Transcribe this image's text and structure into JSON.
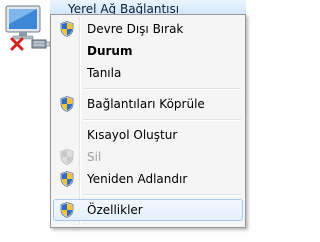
{
  "connection": {
    "name": "Yerel Ağ Bağlantısı",
    "icon": "network-computer-icon",
    "status_icon": "disabled-x-icon"
  },
  "menu": {
    "items": [
      {
        "label": "Devre Dışı Bırak",
        "icon": "uac-shield-icon"
      },
      {
        "label": "Durum",
        "bold": true
      },
      {
        "label": "Tanıla"
      },
      {
        "label": "Bağlantıları Köprüle",
        "icon": "uac-shield-icon"
      },
      {
        "label": "Kısayol Oluştur"
      },
      {
        "label": "Sil",
        "icon": "uac-shield-icon",
        "disabled": true
      },
      {
        "label": "Yeniden Adlandır",
        "icon": "uac-shield-icon"
      },
      {
        "label": "Özellikler",
        "icon": "uac-shield-icon",
        "hovered": true
      }
    ]
  },
  "colors": {
    "menu_background": "#f5f5f5",
    "menu_border": "#979797",
    "hover_border": "#a8cbef",
    "disabled_text": "#a0a0a0"
  }
}
